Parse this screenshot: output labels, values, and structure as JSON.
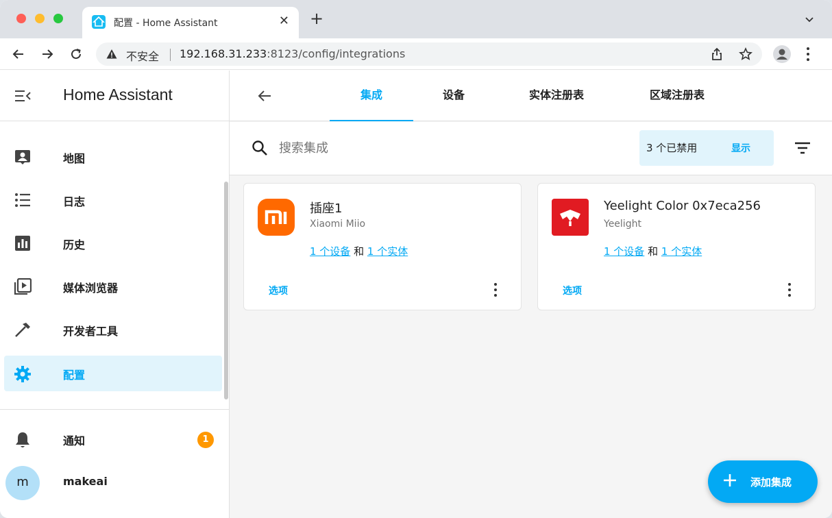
{
  "browser": {
    "tab_title": "配置 - Home Assistant",
    "security_label": "不安全",
    "url_host": "192.168.31.233",
    "url_rest": ":8123/config/integrations"
  },
  "sidebar": {
    "title": "Home Assistant",
    "items": [
      {
        "label": "地图",
        "icon": "map-icon"
      },
      {
        "label": "日志",
        "icon": "list-icon"
      },
      {
        "label": "历史",
        "icon": "chart-icon"
      },
      {
        "label": "媒体浏览器",
        "icon": "media-icon"
      },
      {
        "label": "开发者工具",
        "icon": "hammer-icon"
      },
      {
        "label": "配置",
        "icon": "gear-icon",
        "active": true
      }
    ],
    "notifications": {
      "label": "通知",
      "count": "1"
    },
    "user": {
      "initial": "m",
      "name": "makeai"
    }
  },
  "main": {
    "tabs": [
      "集成",
      "设备",
      "实体注册表",
      "区域注册表"
    ],
    "active_tab": "集成",
    "search": {
      "placeholder": "搜索集成"
    },
    "disabled": {
      "text": "3 个已禁用",
      "show_label": "显示"
    },
    "cards": [
      {
        "title": "插座1",
        "subtitle": "Xiaomi Miio",
        "devices_link": "1 个设备",
        "conjunction": "和",
        "entities_link": "1 个实体",
        "options_label": "选项",
        "logo_color": "#ff6900",
        "logo_text": "mi"
      },
      {
        "title": "Yeelight Color 0x7eca256",
        "subtitle": "Yeelight",
        "devices_link": "1 个设备",
        "conjunction": "和",
        "entities_link": "1 个实体",
        "options_label": "选项",
        "logo_color": "#e11b22",
        "logo_text": "yeelight"
      }
    ],
    "fab_label": "添加集成"
  },
  "colors": {
    "accent": "#03a9f4",
    "badge": "#ff9800"
  }
}
